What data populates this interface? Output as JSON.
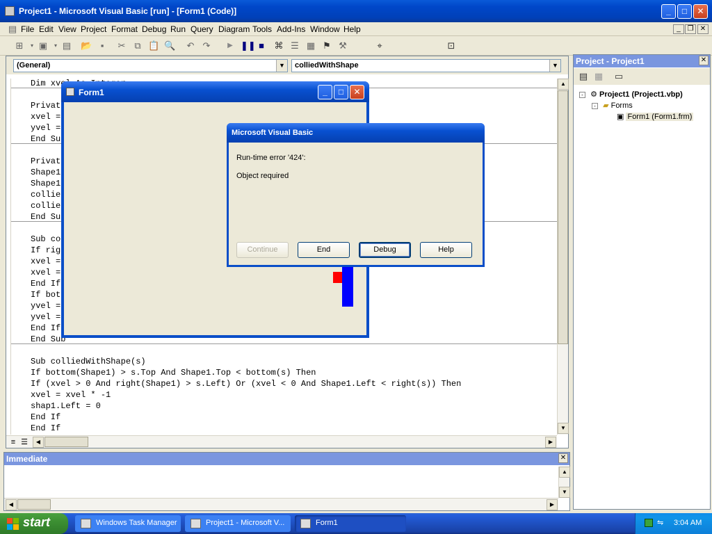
{
  "window": {
    "title": "Project1 - Microsoft Visual Basic [run] - [Form1 (Code)]"
  },
  "menu": [
    "File",
    "Edit",
    "View",
    "Project",
    "Format",
    "Debug",
    "Run",
    "Query",
    "Diagram",
    "Tools",
    "Add-Ins",
    "Window",
    "Help"
  ],
  "code_window": {
    "object_combo": "(General)",
    "procedure_combo": "colliedWithShape",
    "lines": [
      "Dim xvel As Integer",
      "",
      "Private Sub Form_Load()",
      "xvel = 1",
      "yvel = 1",
      "End Sub",
      "",
      "Private Sub Timer1_Timer()",
      "Shape1.Left = Shape1.Left + xvel",
      "Shape1.Top = Shape1.Top + yvel",
      "colliedWithShape Shape2",
      "colliedWithShape Shape3",
      "End Sub",
      "",
      "Sub colliedWithForm()",
      "If right(Shape1) > ScaleWidth Then",
      "xvel = xvel * -1",
      "xvel = 0",
      "End If",
      "If bottom(Shape1) > ScaleHeight Then",
      "yvel = yvel * -1",
      "yvel = 0",
      "End If",
      "End Sub",
      "",
      "Sub colliedWithShape(s)",
      "If bottom(Shape1) > s.Top And Shape1.Top < bottom(s) Then",
      "If (xvel > 0 And right(Shape1) > s.Left) Or (xvel < 0 And Shape1.Left < right(s)) Then",
      "xvel = xvel * -1",
      "shap1.Left = 0",
      "End If",
      "End If"
    ]
  },
  "project_explorer": {
    "title": "Project - Project1",
    "project_node": "Project1 (Project1.vbp)",
    "forms_folder": "Forms",
    "form_node": "Form1 (Form1.frm)"
  },
  "immediate": {
    "title": "Immediate"
  },
  "form1": {
    "title": "Form1"
  },
  "error_dialog": {
    "title": "Microsoft Visual Basic",
    "error_line": "Run-time error '424':",
    "message": "Object required",
    "buttons": {
      "continue": "Continue",
      "end": "End",
      "debug": "Debug",
      "help": "Help"
    }
  },
  "taskbar": {
    "start_label": "start",
    "tasks": [
      "Windows Task Manager",
      "Project1 - Microsoft V...",
      "Form1"
    ],
    "clock": "3:04 AM"
  },
  "colors": {
    "shape_red": "#ff0000",
    "shape_blue": "#0000ff",
    "title_blue": "#0047c9",
    "panel_title_blue": "#7a96df"
  }
}
